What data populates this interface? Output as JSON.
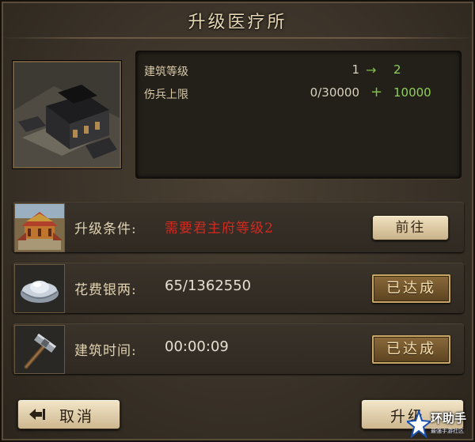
{
  "dialog": {
    "title": "升级医疗所"
  },
  "stats": [
    {
      "label": "建筑等级",
      "current": "1",
      "op": "→",
      "next": "2"
    },
    {
      "label": "伤兵上限",
      "current": "0/30000",
      "op": "+",
      "next": "10000"
    }
  ],
  "requirements": [
    {
      "label": "升级条件:",
      "value": "需要君主府等级2",
      "action": "前往",
      "icon": "palace-icon"
    },
    {
      "label": "花费银两:",
      "value": "65/1362550",
      "status": "已达成",
      "icon": "silver-ingot-icon"
    },
    {
      "label": "建筑时间:",
      "value": "00:00:09",
      "status": "已达成",
      "icon": "hammer-icon"
    }
  ],
  "footer": {
    "cancel_label": "取消",
    "upgrade_label": "升级"
  },
  "watermark": {
    "title": "环助手",
    "subtitle": "最强手游社区"
  },
  "colors": {
    "requirement_unmet": "#d02a20",
    "increase_green": "#8fd05a",
    "accent_gold": "#c8a766"
  }
}
